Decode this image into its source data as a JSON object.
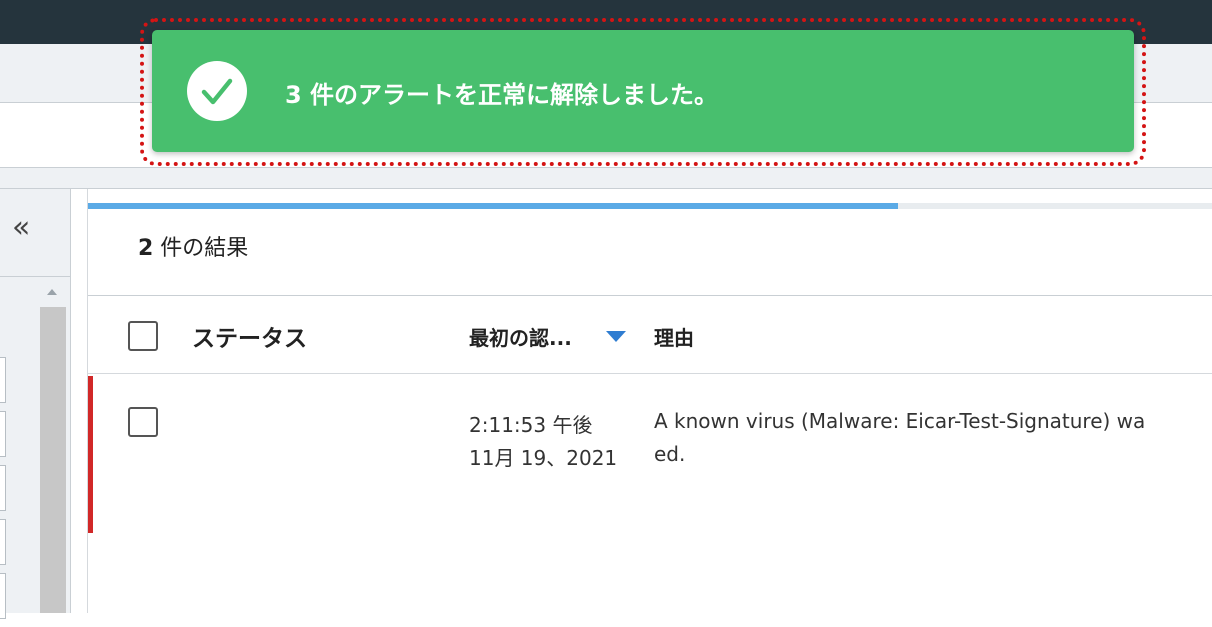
{
  "toast": {
    "icon": "check-circle-icon",
    "message": "3 件のアラートを正常に解除しました。",
    "color": "#48bf6e",
    "highlight_color": "#d41414"
  },
  "sidebar": {
    "collapse_icon": "double-chevron-left-icon",
    "collapse_glyph": "«"
  },
  "results": {
    "count": "2",
    "suffix": " 件の結果"
  },
  "progress": {
    "fill_percent": 72,
    "color": "#5aaae6"
  },
  "table": {
    "columns": {
      "status": "ステータス",
      "first_seen": "最初の認...",
      "reason": "理由"
    },
    "sort_icon": "sort-desc-icon",
    "rows": [
      {
        "status": "",
        "first_seen_time": "2:11:53 午後",
        "first_seen_date": "11月 19、2021",
        "reason_line1": "A known virus (Malware: Eicar-Test-Signature) wa",
        "reason_line2": "ed.",
        "severity_color": "#d12828"
      }
    ]
  }
}
